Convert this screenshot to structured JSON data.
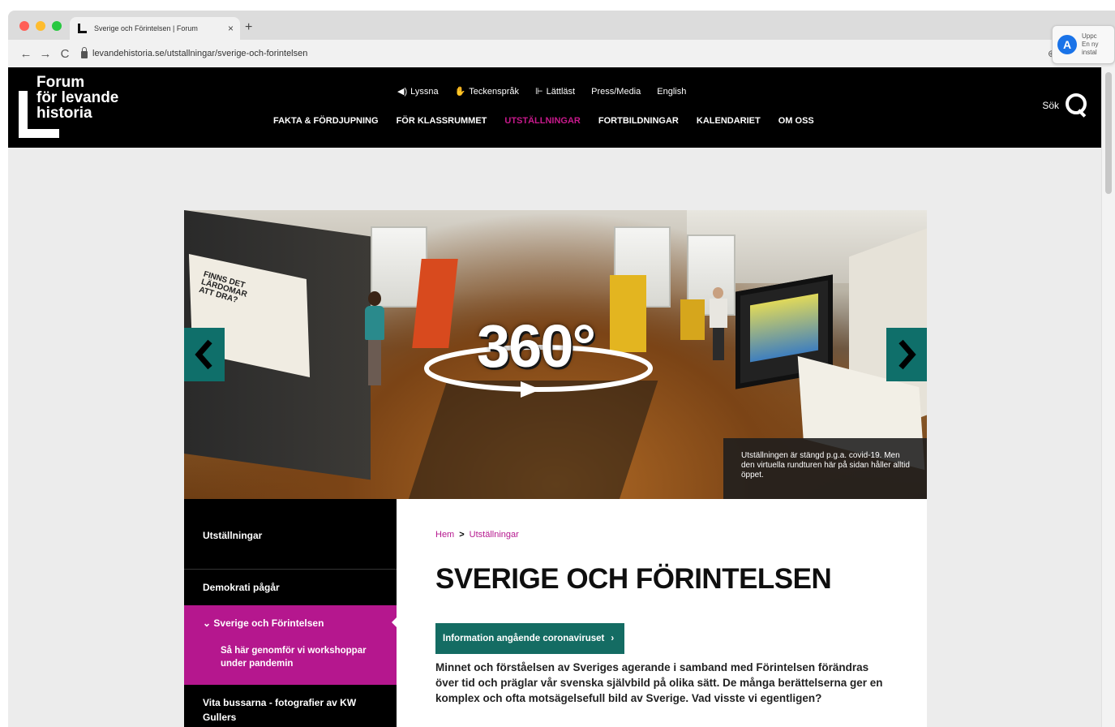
{
  "browser": {
    "tab_title": "Sverige och Förintelsen | Forum",
    "tab_close": "×",
    "new_tab": "+",
    "url": "levandehistoria.se/utstallningar/sverige-och-forintelsen",
    "nav_back": "←",
    "nav_forward": "→",
    "nav_reload": "C",
    "zoom_icon": "⊕",
    "star_icon": "☆",
    "extension_popup": {
      "icon": "A",
      "lines": [
        "Uppc",
        "En ny",
        "instal"
      ]
    }
  },
  "header": {
    "logo_text": "Forum\nför levande\nhistoria",
    "utility_nav": [
      {
        "icon": "◀)",
        "label": "Lyssna"
      },
      {
        "icon": "✋",
        "label": "Teckenspråk"
      },
      {
        "icon": "⊩",
        "label": "Lättläst"
      },
      {
        "icon": "",
        "label": "Press/Media"
      },
      {
        "icon": "",
        "label": "English"
      }
    ],
    "main_nav": [
      {
        "label": "FAKTA & FÖRDJUPNING",
        "active": false
      },
      {
        "label": "FÖR KLASSRUMMET",
        "active": false
      },
      {
        "label": "UTSTÄLLNINGAR",
        "active": true
      },
      {
        "label": "FORTBILDNINGAR",
        "active": false
      },
      {
        "label": "KALENDARIET",
        "active": false
      },
      {
        "label": "OM OSS",
        "active": false
      }
    ],
    "search_label": "Sök",
    "active_color": "#c8198c"
  },
  "hero": {
    "badge_text": "360°",
    "panel_text": "FINNS DET\nLÄRDOMAR\nATT DRA?",
    "prev_label": "‹",
    "next_label": "›",
    "caption": "Utställningen är stängd p.g.a. covid-19. Men den virtuella rundturen här på sidan håller alltid öppet."
  },
  "side_nav": {
    "items": [
      {
        "label": "Utställningar"
      },
      {
        "label": "Demokrati pågår"
      },
      {
        "label": "⌄ Sverige och Förintelsen"
      },
      {
        "label": "Så här genomför vi workshoppar under pandemin"
      },
      {
        "label": "Vita bussarna - fotografier av KW Gullers"
      }
    ],
    "active_color": "#b5178e"
  },
  "main": {
    "breadcrumb": {
      "home": "Hem",
      "sep": ">",
      "current": "Utställningar"
    },
    "title": "SVERIGE OCH FÖRINTELSEN",
    "info_button": "Information angående coronaviruset",
    "info_button_arrow": "›",
    "intro": "Minnet och förståelsen av Sveriges agerande i samband med Förintelsen förändras över tid och präglar vår svenska självbild på olika sätt. De många berättelserna ger en komplex och ofta motsägelsefull bild av Sverige. Vad visste vi egentligen?"
  }
}
